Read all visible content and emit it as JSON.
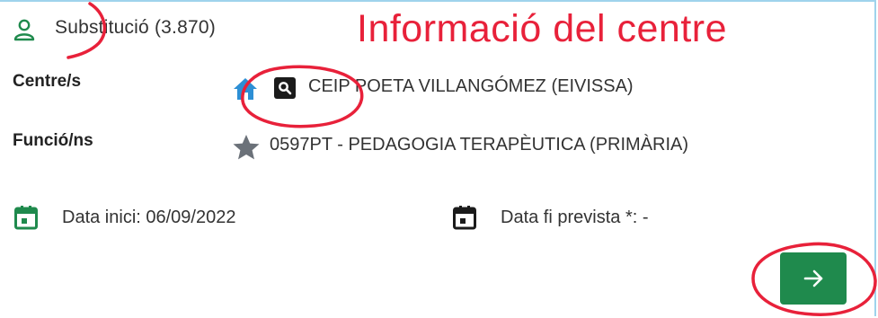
{
  "header": {
    "person_icon": "person-outline-icon",
    "title": "Substitució (3.870)",
    "overlay_title": "Informació del centre"
  },
  "centre": {
    "label": "Centre/s",
    "home_icon": "home-icon",
    "search_icon": "search-icon",
    "value": "CEIP POETA VILLANGÓMEZ (EIVISSA)"
  },
  "funcio": {
    "label": "Funció/ns",
    "star_icon": "star-icon",
    "value": "0597PT - PEDAGOGIA TERAPÈUTICA (PRIMÀRIA)"
  },
  "dates": {
    "start_icon": "calendar-icon",
    "start_text": "Data inici: 06/09/2022",
    "end_icon": "calendar-icon",
    "end_text": "Data fi prevista *: -"
  },
  "action": {
    "next_icon": "arrow-right-icon"
  },
  "colors": {
    "accent_green": "#1f8a4d",
    "home_blue": "#2d8fd5",
    "annotation_red": "#e8213a",
    "border_blue": "#9fd3ec"
  }
}
